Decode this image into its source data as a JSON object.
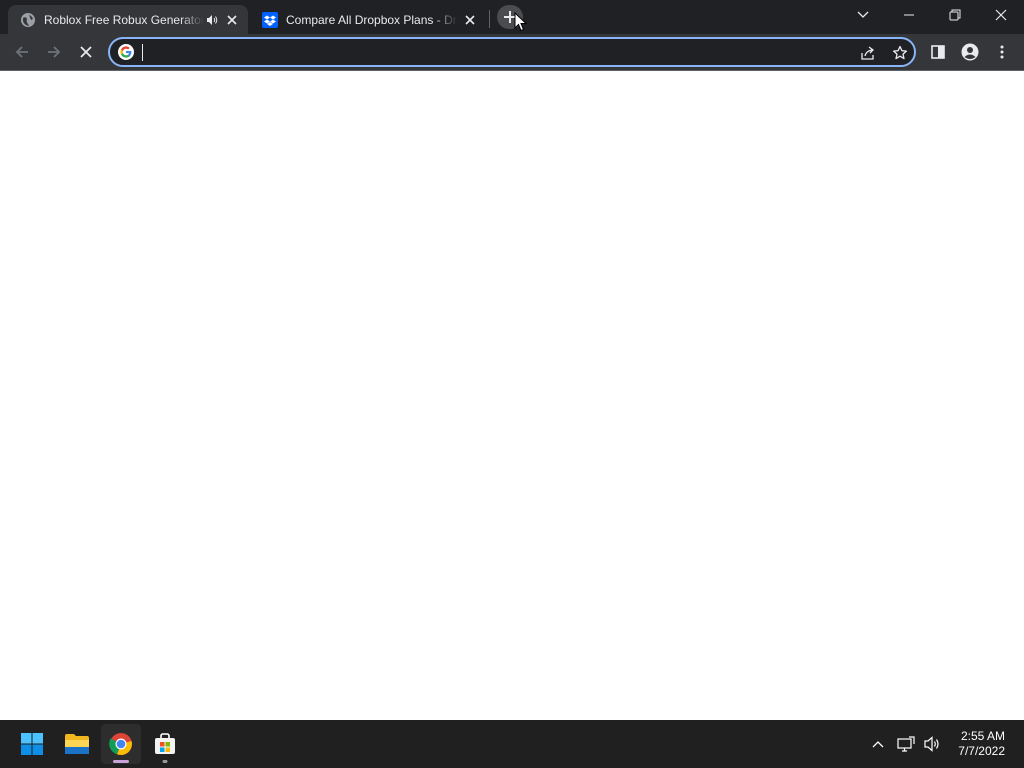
{
  "browser": {
    "tabs": [
      {
        "title": "Roblox Free Robux Generator",
        "favicon": "globe-icon",
        "audio": "speaker-icon",
        "active": true
      },
      {
        "title": "Compare All Dropbox Plans - Dropbox",
        "favicon": "dropbox-icon",
        "active": false
      }
    ],
    "new_tab_icon": "plus-icon",
    "window_controls": [
      "chevron-down-icon",
      "minimize-icon",
      "restore-icon",
      "close-icon"
    ],
    "toolbar": {
      "back_icon": "arrow-left-icon",
      "forward_icon": "arrow-right-icon",
      "stop_icon": "stop-icon",
      "omnibox": {
        "value": "",
        "placeholder": "",
        "provider_icon": "google-icon"
      },
      "share_icon": "share-icon",
      "bookmark_icon": "star-icon",
      "side_panel_icon": "side-panel-icon",
      "profile_icon": "profile-icon",
      "menu_icon": "kebab-menu-icon"
    }
  },
  "taskbar": {
    "apps": [
      {
        "name": "start",
        "icon": "windows-start-icon",
        "running": false
      },
      {
        "name": "file-explorer",
        "icon": "folder-icon",
        "running": false
      },
      {
        "name": "chrome",
        "icon": "chrome-icon",
        "running": true
      },
      {
        "name": "store",
        "icon": "store-icon",
        "running": true
      }
    ],
    "tray": [
      "chevron-up-icon",
      "network-icon",
      "volume-icon"
    ],
    "clock": {
      "time": "2:55 AM",
      "date": "7/7/2022"
    }
  },
  "colors": {
    "tabstrip": "#202124",
    "active_tab": "#35363a",
    "omnibox_focus": "#8ab4f8",
    "taskbar": "#202020",
    "chrome_indicator": "#c8a2d8"
  }
}
